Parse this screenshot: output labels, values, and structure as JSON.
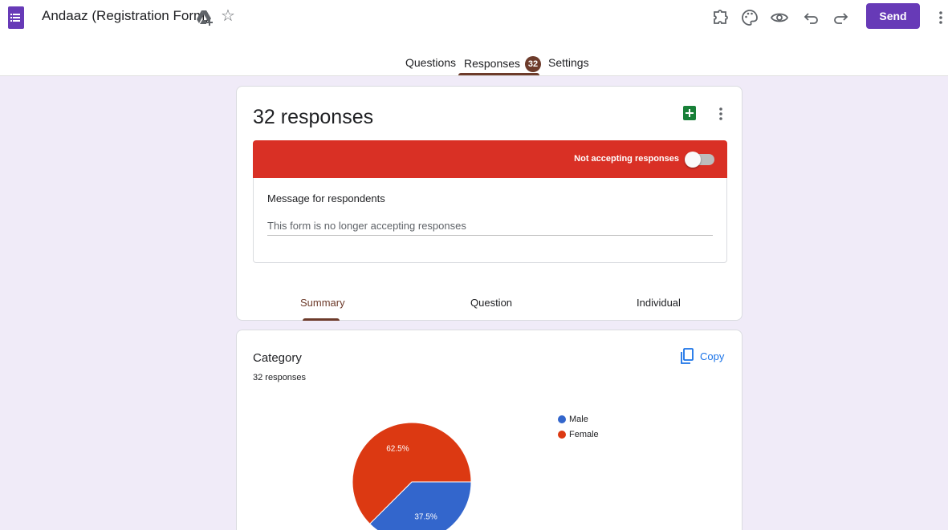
{
  "header": {
    "title": "Andaaz (Registration Form)",
    "send_label": "Send",
    "accent": "#673ab7"
  },
  "tabs": [
    {
      "label": "Questions"
    },
    {
      "label": "Responses",
      "badge": "32"
    },
    {
      "label": "Settings"
    }
  ],
  "summary": {
    "title": "32 responses",
    "banner_text": "Not accepting responses",
    "accepting": false,
    "message_label": "Message for respondents",
    "message_value": "This form is no longer accepting responses"
  },
  "subtabs": [
    "Summary",
    "Question",
    "Individual"
  ],
  "question": {
    "title": "Category",
    "count": "32 responses",
    "copy_label": "Copy"
  },
  "chart_data": {
    "type": "pie",
    "categories": [
      "Male",
      "Female"
    ],
    "values": [
      37.5,
      62.5
    ],
    "labels": [
      "37.5%",
      "62.5%"
    ],
    "colors": [
      "#3366cc",
      "#dc3912"
    ],
    "legend": "right"
  },
  "icons": [
    "forms-icon",
    "drive-icon",
    "star-icon",
    "addon-icon",
    "palette-icon",
    "preview-icon",
    "undo-icon",
    "redo-icon",
    "more-icon",
    "sheets-icon",
    "copy-icon"
  ]
}
